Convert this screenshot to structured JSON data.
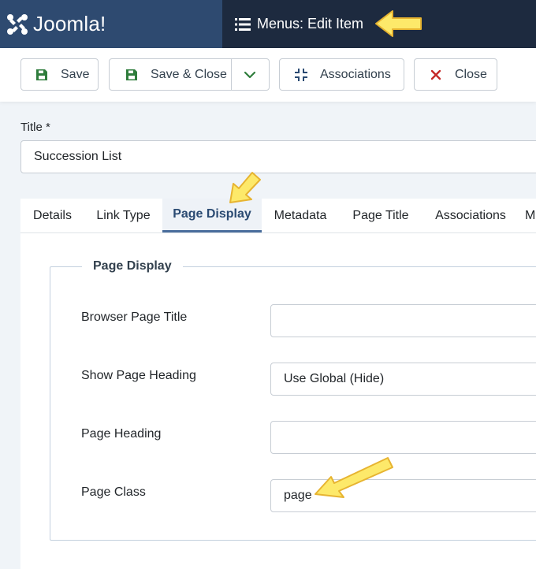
{
  "brand": {
    "name": "Joomla!"
  },
  "header": {
    "title": "Menus: Edit Item",
    "icon": "list-icon"
  },
  "toolbar": {
    "save_label": "Save",
    "save_close_label": "Save & Close",
    "associations_label": "Associations",
    "close_label": "Close"
  },
  "title_field": {
    "label": "Title *",
    "value": "Succession List"
  },
  "tabs": [
    {
      "label": "Details"
    },
    {
      "label": "Link Type"
    },
    {
      "label": "Page Display",
      "active": true
    },
    {
      "label": "Metadata"
    },
    {
      "label": "Page Title"
    },
    {
      "label": "Associations"
    },
    {
      "label": "M"
    }
  ],
  "page_display": {
    "legend": "Page Display",
    "fields": [
      {
        "label": "Browser Page Title",
        "value": ""
      },
      {
        "label": "Show Page Heading",
        "value": "Use Global (Hide)"
      },
      {
        "label": "Page Heading",
        "value": ""
      },
      {
        "label": "Page Class",
        "value": "page"
      }
    ]
  },
  "colors": {
    "header_bg": "#1d2a3f",
    "brand_bg": "#2e4a70",
    "save_icon": "#2f7d3c",
    "close_icon": "#c52827",
    "assoc_icon": "#2a4a72",
    "arrow": "#fde96a"
  }
}
